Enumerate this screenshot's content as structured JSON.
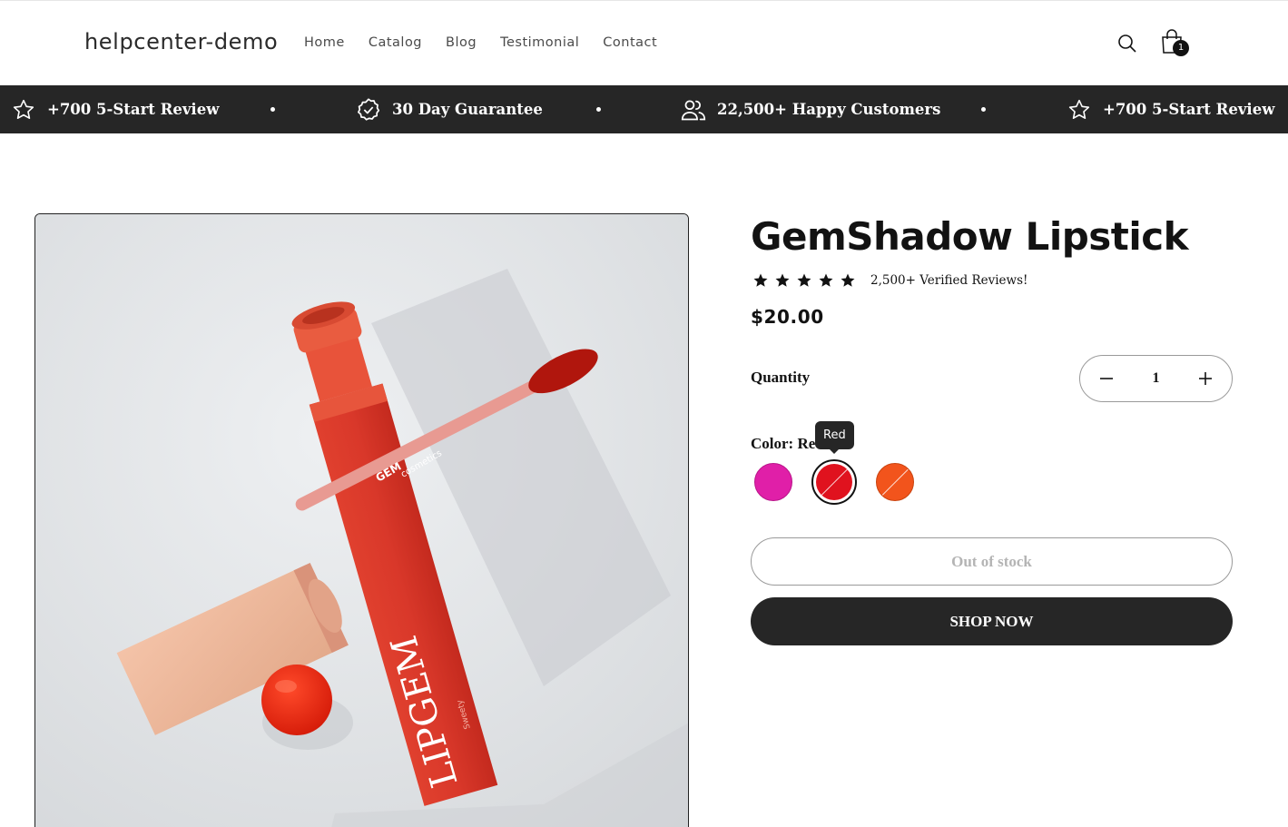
{
  "header": {
    "logo": "helpcenter-demo",
    "nav": [
      "Home",
      "Catalog",
      "Blog",
      "Testimonial",
      "Contact"
    ],
    "cart_count": "1",
    "icons": [
      "search-icon",
      "cart-icon"
    ]
  },
  "announcement": {
    "items": [
      {
        "icon": "star-icon",
        "text": "+700 5-Start Review"
      },
      {
        "icon": "badge-check-icon",
        "text": "30 Day Guarantee"
      },
      {
        "icon": "users-icon",
        "text": "22,500+ Happy Customers"
      },
      {
        "icon": "star-icon",
        "text": "+700 5-Start Review"
      }
    ]
  },
  "product": {
    "title": "GemShadow Lipstick",
    "rating_stars": 5,
    "rating_text": "2,500+ Verified Reviews!",
    "price": "$20.00",
    "quantity_label": "Quantity",
    "quantity_value": "1",
    "color_label": "Color: Red",
    "tooltip": "Red",
    "swatches": [
      {
        "name": "Magenta",
        "color": "#e01fa8",
        "selected": false
      },
      {
        "name": "Red",
        "color": "#e0121e",
        "selected": true
      },
      {
        "name": "Orange",
        "color": "#f2541c",
        "selected": false
      }
    ],
    "out_of_stock_label": "Out of stock",
    "shop_now_label": "SHOP NOW",
    "image_text": {
      "brand": "LIPGEM",
      "sub": "Sweety",
      "cap_brand": "GEM",
      "cap_sub": "cosmetics"
    }
  },
  "colors": {
    "dark": "#262626",
    "text": "#121212",
    "muted": "#b4b4b4"
  }
}
